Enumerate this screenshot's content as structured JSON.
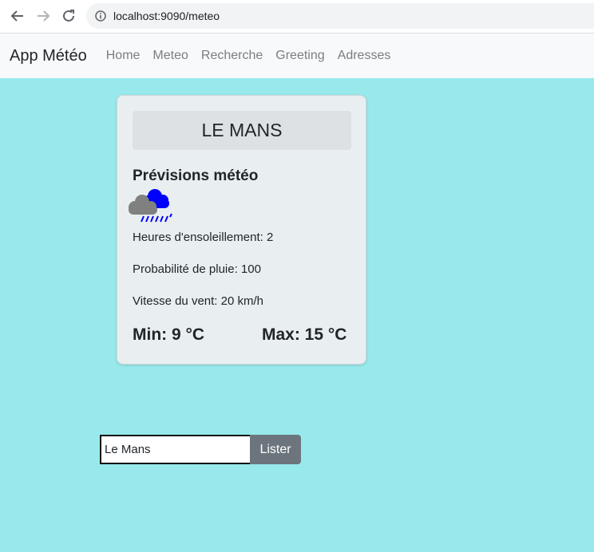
{
  "browser": {
    "url": "localhost:9090/meteo",
    "back_icon": "arrow-left-icon",
    "forward_icon": "arrow-right-icon",
    "reload_icon": "reload-icon",
    "info_icon": "info-icon"
  },
  "navbar": {
    "brand": "App Météo",
    "links": [
      "Home",
      "Meteo",
      "Recherche",
      "Greeting",
      "Adresses"
    ]
  },
  "card": {
    "city": "LE MANS",
    "title": "Prévisions météo",
    "icon": "rain-cloud-icon",
    "sunshine": "Heures d'ensoleillement: 2",
    "rain": "Probabilité de pluie: 100",
    "wind": "Vitesse du vent: 20 km/h",
    "min": "Min: 9 °C",
    "max": "Max: 15 °C"
  },
  "search": {
    "value": "Le Mans",
    "button": "Lister"
  },
  "colors": {
    "page_bg": "#98e9eb",
    "navbar_bg": "#f8f9fa",
    "card_bg": "#e9eff1",
    "button_bg": "#6c757d",
    "rain_blue": "#0000ff",
    "cloud_gray": "#808080"
  }
}
